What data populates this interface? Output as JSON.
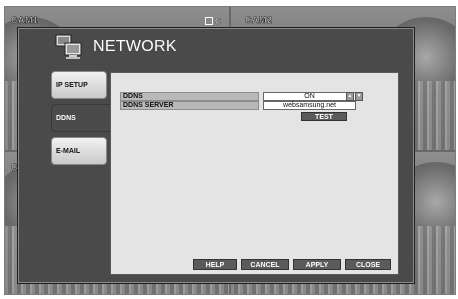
{
  "cameras": [
    {
      "label": "CAM1"
    },
    {
      "label": "CAM2"
    },
    {
      "label": "CAM3"
    },
    {
      "label": ""
    }
  ],
  "status_indicator": "C",
  "dialog": {
    "title": "NETWORK",
    "icon": "network-monitors-icon",
    "sidebar": [
      {
        "label": "IP SETUP",
        "active": false
      },
      {
        "label": "DDNS",
        "active": true
      },
      {
        "label": "E-MAIL",
        "active": false
      }
    ],
    "fields": {
      "ddns": {
        "label": "DDNS",
        "value": "ON"
      },
      "ddns_server": {
        "label": "DDNS SERVER",
        "value": "websamsung.net"
      }
    },
    "test_label": "TEST",
    "buttons": {
      "help": "HELP",
      "cancel": "CANCEL",
      "apply": "APPLY",
      "close": "CLOSE"
    }
  },
  "colors": {
    "dialog_bg": "#4a4a4a",
    "panel_bg": "#e4e4e4",
    "button_bg": "#5b5b5b",
    "active_tab": "#4b4b4b"
  }
}
